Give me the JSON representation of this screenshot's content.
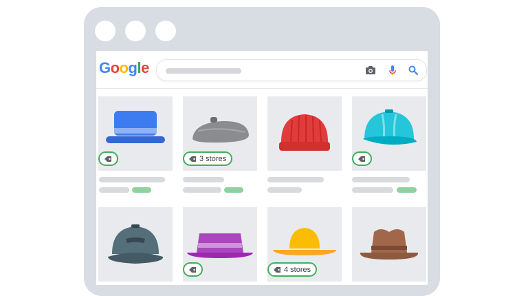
{
  "browser": {
    "controls": [
      "dot",
      "dot",
      "dot"
    ]
  },
  "google": {
    "logo_letters": [
      {
        "char": "G",
        "color": "#4285F4"
      },
      {
        "char": "o",
        "color": "#EA4335"
      },
      {
        "char": "o",
        "color": "#FBBC05"
      },
      {
        "char": "g",
        "color": "#4285F4"
      },
      {
        "char": "l",
        "color": "#34A853"
      },
      {
        "char": "e",
        "color": "#EA4335"
      }
    ],
    "search_icons": [
      "camera-icon",
      "microphone-icon",
      "search-icon"
    ]
  },
  "products": [
    {
      "name": "blue-fedora",
      "color": "#4285F4",
      "stores_label": ""
    },
    {
      "name": "gray-beret",
      "color": "#8a8c8f",
      "stores_label": "3 stores"
    },
    {
      "name": "red-beanie",
      "color": "#e53935",
      "stores_label": ""
    },
    {
      "name": "cyan-cap",
      "color": "#26c6da",
      "stores_label": ""
    },
    {
      "name": "slate-cap",
      "color": "#546e7a",
      "stores_label": ""
    },
    {
      "name": "purple-bucket-hat",
      "color": "#ab47bc",
      "stores_label": ""
    },
    {
      "name": "yellow-sun-hat",
      "color": "#fbbc05",
      "stores_label": "4 stores"
    },
    {
      "name": "brown-fedora",
      "color": "#a1674a",
      "stores_label": ""
    }
  ],
  "colors": {
    "accent_green": "#3fae5d",
    "window_frame": "#d8dce3",
    "card_bg": "#e9eaee"
  }
}
